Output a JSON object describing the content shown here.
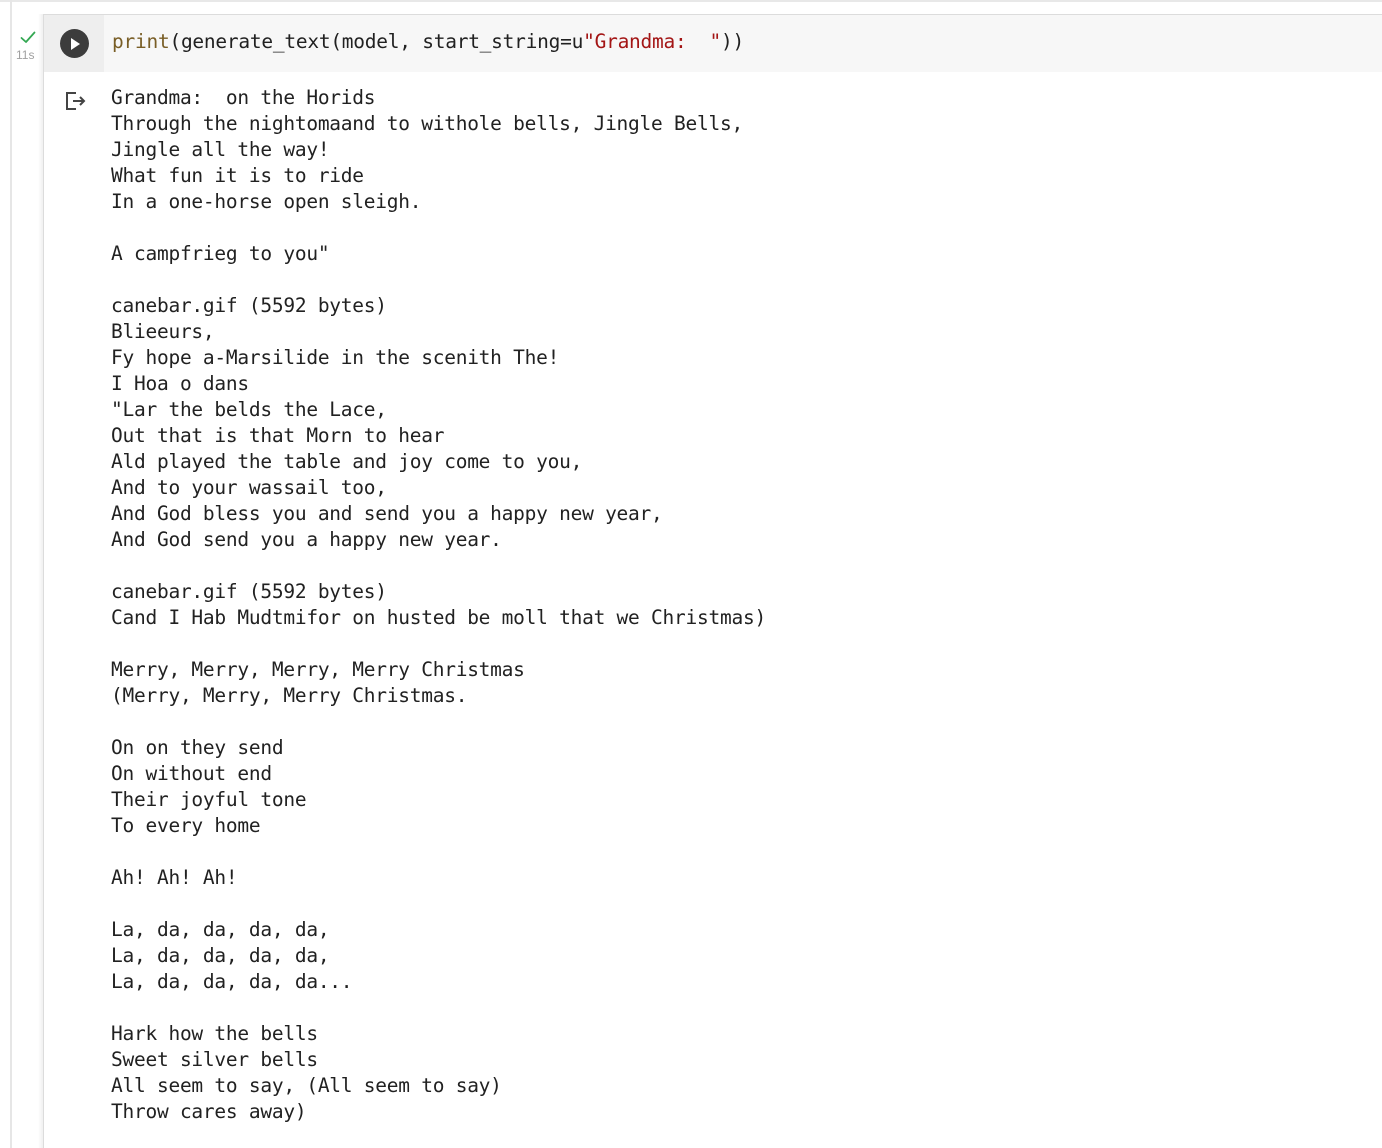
{
  "cell": {
    "exec_time": "11s",
    "code": {
      "builtin": "print",
      "before_string": "(generate_text(model, start_string=u",
      "string": "\"Grandma:  \"",
      "after_string": "))"
    }
  },
  "output": {
    "lines": [
      "Grandma:  on the Horids",
      "Through the nightomaand to withole bells, Jingle Bells,",
      "Jingle all the way!",
      "What fun it is to ride",
      "In a one-horse open sleigh.",
      "",
      "A campfrieg to you\"",
      "",
      "canebar.gif (5592 bytes)",
      "Blieeurs,",
      "Fy hope a-Marsilide in the scenith The!",
      "I Hoa o dans",
      "\"Lar the belds the Lace,",
      "Out that is that Morn to hear",
      "Ald played the table and joy come to you,",
      "And to your wassail too,",
      "And God bless you and send you a happy new year,",
      "And God send you a happy new year.",
      "",
      "canebar.gif (5592 bytes)",
      "Cand I Hab Mudtmifor on husted be moll that we Christmas)",
      "",
      "Merry, Merry, Merry, Merry Christmas",
      "(Merry, Merry, Merry Christmas.",
      "",
      "On on they send",
      "On without end",
      "Their joyful tone",
      "To every home",
      "",
      "Ah! Ah! Ah!",
      "",
      "La, da, da, da, da,",
      "La, da, da, da, da,",
      "La, da, da, da, da...",
      "",
      "Hark how the bells",
      "Sweet silver bells",
      "All seem to say, (All seem to say)",
      "Throw cares away)"
    ]
  },
  "colors": {
    "check": "#34a853",
    "string": "#a31515",
    "builtin": "#795e26",
    "run_button": "#3c3c3c"
  },
  "icons": {
    "run": "play-circle-icon",
    "status": "checkmark-icon",
    "output": "output-exit-icon"
  }
}
